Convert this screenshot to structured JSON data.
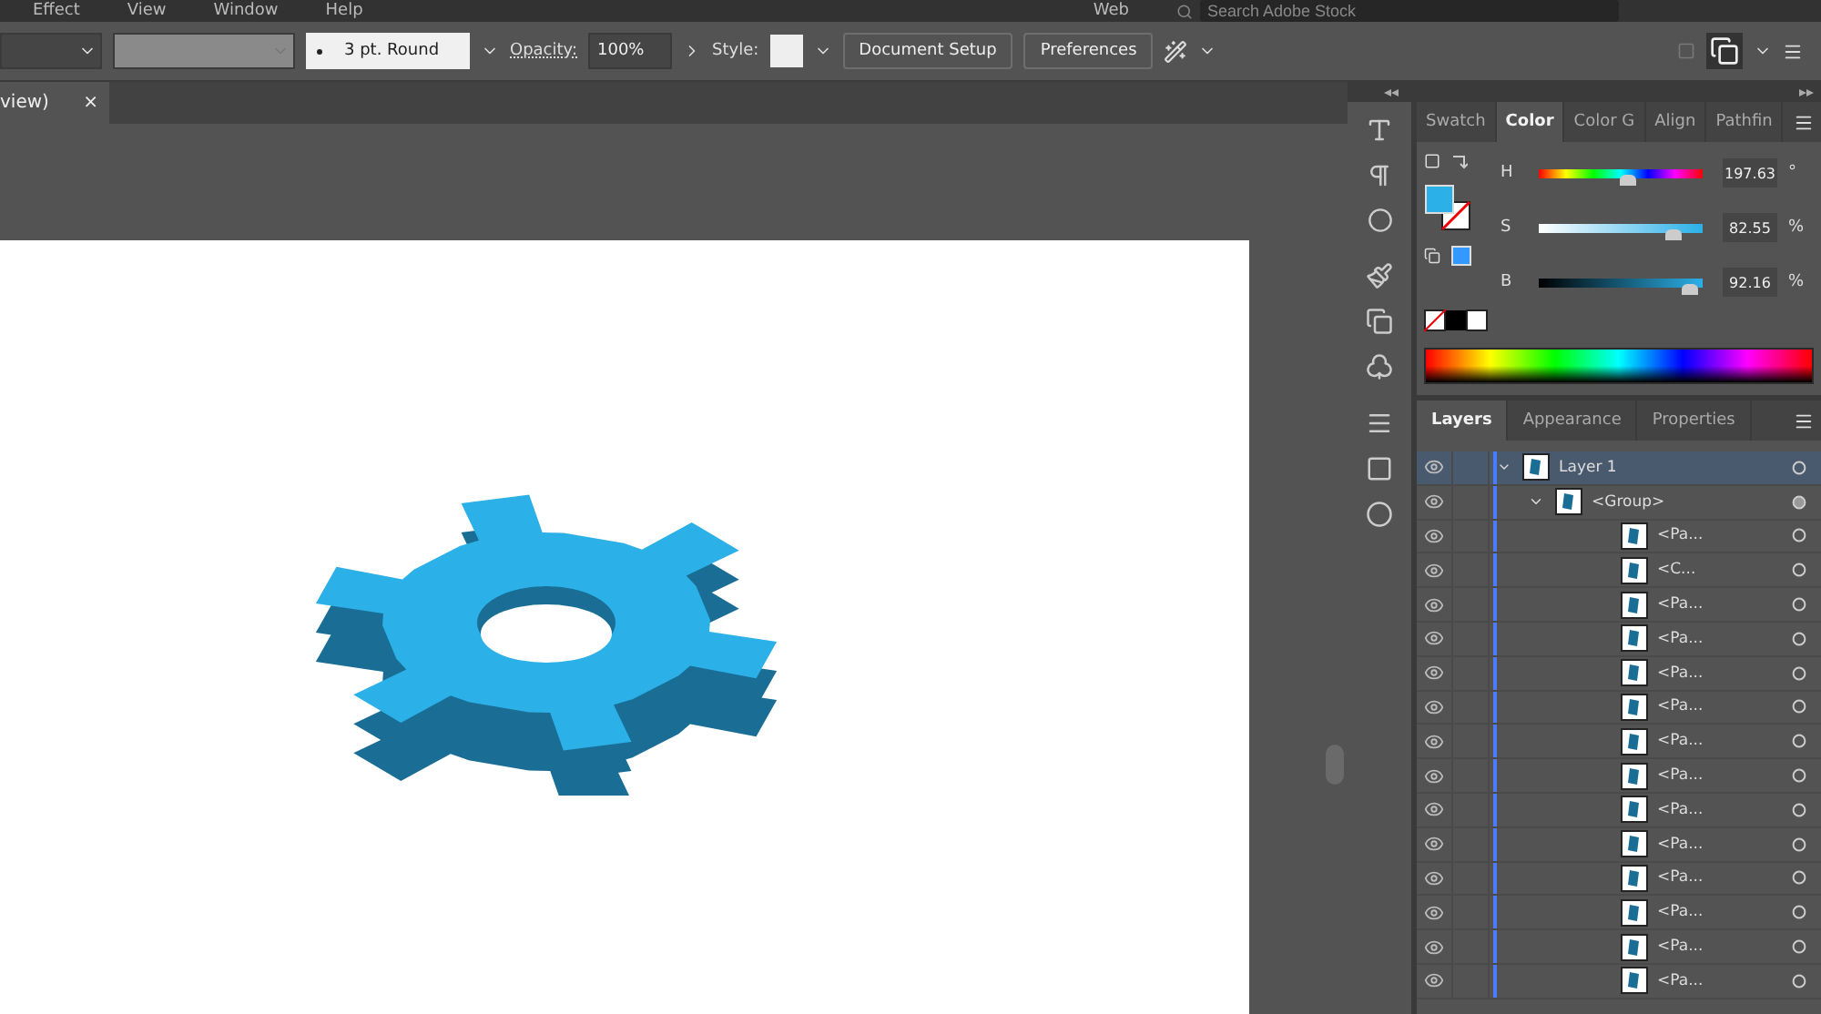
{
  "menu": [
    "Effect",
    "View",
    "Window",
    "Help"
  ],
  "workspace": "Web",
  "search": {
    "placeholder": "Search Adobe Stock"
  },
  "control_bar": {
    "stroke": "3 pt. Round",
    "opacity_label": "Opacity:",
    "opacity": "100%",
    "style_label": "Style:",
    "buttons": [
      "Document Setup",
      "Preferences"
    ]
  },
  "document_tab": {
    "title": "view)",
    "close": "×"
  },
  "color_panel": {
    "tabs": [
      {
        "label": "Swatch",
        "selected": false
      },
      {
        "label": "Color",
        "selected": true
      },
      {
        "label": "Color G",
        "selected": false
      },
      {
        "label": "Align",
        "selected": false
      },
      {
        "label": "Pathfin",
        "selected": false
      }
    ],
    "channels": [
      {
        "name": "H",
        "level": 0.549,
        "value": "197.63",
        "unit": "°"
      },
      {
        "name": "S",
        "level": 0.8255,
        "value": "82.55",
        "unit": "%"
      },
      {
        "name": "B",
        "level": 0.9216,
        "value": "92.16",
        "unit": "%"
      }
    ]
  },
  "layers_panel": {
    "tabs": [
      {
        "label": "Layers",
        "selected": true
      },
      {
        "label": "Appearance",
        "selected": false
      },
      {
        "label": "Properties",
        "selected": false
      }
    ],
    "layers": [
      {
        "name": "Layer 1",
        "selected": true,
        "expanded": true,
        "children": [
          {
            "name": "<Group>",
            "selected": false,
            "expanded": true,
            "children": [
              {
                "name": "<Pa...",
                "selected": false
              },
              {
                "name": "<C...",
                "selected": false
              },
              {
                "name": "<Pa...",
                "selected": false
              },
              {
                "name": "<Pa...",
                "selected": false
              },
              {
                "name": "<Pa...",
                "selected": false
              },
              {
                "name": "<Pa...",
                "selected": false
              },
              {
                "name": "<Pa...",
                "selected": false
              },
              {
                "name": "<Pa...",
                "selected": false
              },
              {
                "name": "<Pa...",
                "selected": false
              },
              {
                "name": "<Pa...",
                "selected": false
              },
              {
                "name": "<Pa...",
                "selected": false
              },
              {
                "name": "<Pa...",
                "selected": false
              },
              {
                "name": "<Pa...",
                "selected": false
              },
              {
                "name": "<Pa...",
                "selected": false
              }
            ]
          }
        ]
      }
    ]
  }
}
